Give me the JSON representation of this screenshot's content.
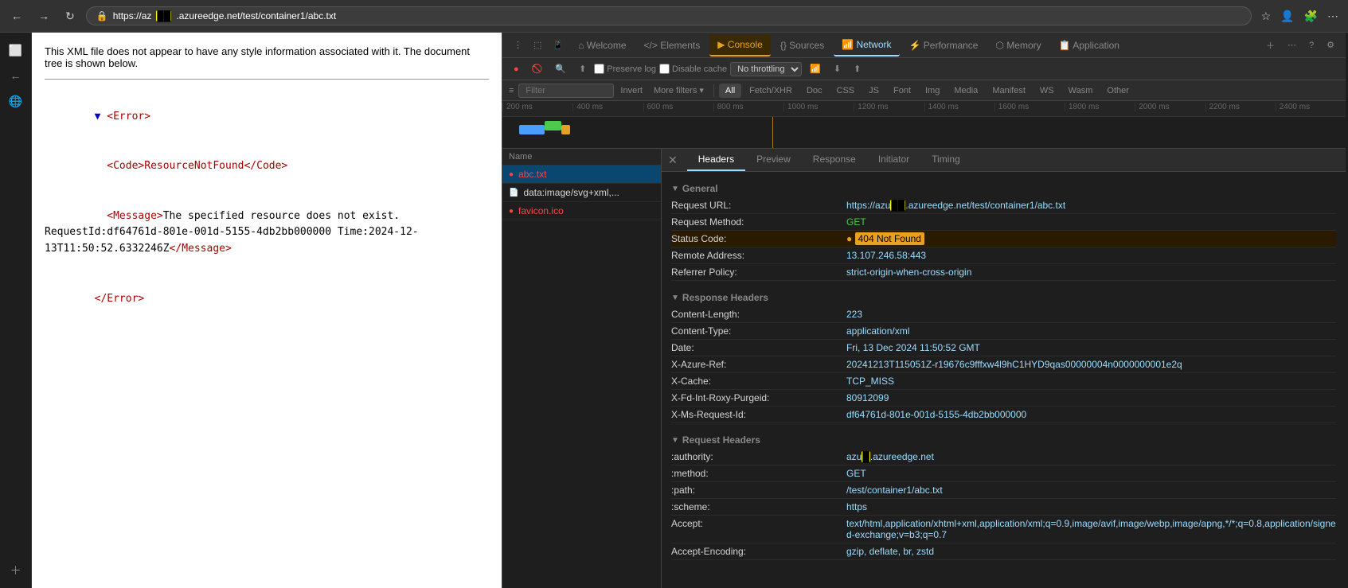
{
  "browser": {
    "address": "https://az",
    "address_highlight": "",
    "address_rest": ".azureedge.net/test/container1/abc.txt",
    "full_url": "https://az__.azureedge.net/test/container1/abc.txt"
  },
  "page": {
    "message": "This XML file does not appear to have any style information associated with it. The document tree is shown below.",
    "xml": {
      "error_open": "<Error>",
      "code_line": "  <Code>ResourceNotFound</Code>",
      "message_line": "  <Message>The specified resource does not exist. RequestId:df64761d-801e-001d-5155-4db2bb000000 Time:2024-12-13T11:50:52.6332246Z</Message>",
      "error_close": "</Error>"
    }
  },
  "devtools": {
    "tabs": [
      {
        "id": "welcome",
        "label": "Welcome",
        "icon": "⌂"
      },
      {
        "id": "elements",
        "label": "Elements",
        "icon": "</>"
      },
      {
        "id": "console",
        "label": "Console",
        "icon": "▶",
        "active_error": true
      },
      {
        "id": "sources",
        "label": "Sources",
        "icon": "{ }"
      },
      {
        "id": "network",
        "label": "Network",
        "icon": "📶",
        "active": true
      },
      {
        "id": "performance",
        "label": "Performance",
        "icon": "⚡"
      },
      {
        "id": "memory",
        "label": "Memory",
        "icon": "⬡"
      },
      {
        "id": "application",
        "label": "Application",
        "icon": "📋"
      }
    ],
    "secondary_toolbar": {
      "preserve_log": "Preserve log",
      "disable_cache": "Disable cache",
      "throttle": "No throttling"
    },
    "filter_tabs": [
      "All",
      "Fetch/XHR",
      "Doc",
      "CSS",
      "JS",
      "Font",
      "Img",
      "Media",
      "Manifest",
      "WS",
      "Wasm",
      "Other"
    ],
    "active_filter": "All",
    "timeline": {
      "ticks": [
        "200 ms",
        "400 ms",
        "600 ms",
        "800 ms",
        "1000 ms",
        "1200 ms",
        "1400 ms",
        "1600 ms",
        "1800 ms",
        "2000 ms",
        "2200 ms",
        "2400 ms"
      ]
    },
    "network_items": [
      {
        "id": "abc-txt",
        "name": "abc.txt",
        "icon": "🔴",
        "error": true,
        "selected": true
      },
      {
        "id": "data-image",
        "name": "data:image/svg+xml,...",
        "icon": "📄",
        "error": false
      },
      {
        "id": "favicon",
        "name": "favicon.ico",
        "icon": "🔴",
        "error": true
      }
    ],
    "request_details": {
      "tabs": [
        "Headers",
        "Preview",
        "Response",
        "Initiator",
        "Timing"
      ],
      "active_tab": "Headers",
      "general": {
        "title": "General",
        "rows": [
          {
            "key": "Request URL:",
            "value": "https://az__.azureedge.net/test/container1/abc.txt",
            "type": "url"
          },
          {
            "key": "Request Method:",
            "value": "GET",
            "type": "method"
          },
          {
            "key": "Status Code:",
            "value": "404 Not Found",
            "type": "status"
          },
          {
            "key": "Remote Address:",
            "value": "13.107.246.58:443",
            "type": "normal"
          },
          {
            "key": "Referrer Policy:",
            "value": "strict-origin-when-cross-origin",
            "type": "normal"
          }
        ]
      },
      "response_headers": {
        "title": "Response Headers",
        "rows": [
          {
            "key": "Content-Length:",
            "value": "223"
          },
          {
            "key": "Content-Type:",
            "value": "application/xml"
          },
          {
            "key": "Date:",
            "value": "Fri, 13 Dec 2024 11:50:52 GMT"
          },
          {
            "key": "X-Azure-Ref:",
            "value": "20241213T115051Z-r19676c9fffxw4l9hC1HYD9qas00000004n0000000001e2q"
          },
          {
            "key": "X-Cache:",
            "value": "TCP_MISS"
          },
          {
            "key": "X-Fd-Int-Roxy-Purgeid:",
            "value": "80912099"
          },
          {
            "key": "X-Ms-Request-Id:",
            "value": "df64761d-801e-001d-5155-4db2bb000000"
          }
        ]
      },
      "request_headers": {
        "title": "Request Headers",
        "rows": [
          {
            "key": ":authority:",
            "value": "azu__.azureedge.net"
          },
          {
            "key": ":method:",
            "value": "GET"
          },
          {
            "key": ":path:",
            "value": "/test/container1/abc.txt"
          },
          {
            "key": ":scheme:",
            "value": "https"
          },
          {
            "key": "Accept:",
            "value": "text/html,application/xhtml+xml,application/xml;q=0.9,image/avif,image/webp,image/apng,*/*;q=0.8,application/signed-exchange;v=b3;q=0.7"
          },
          {
            "key": "Accept-Encoding:",
            "value": "gzip, deflate, br, zstd"
          }
        ]
      }
    }
  }
}
